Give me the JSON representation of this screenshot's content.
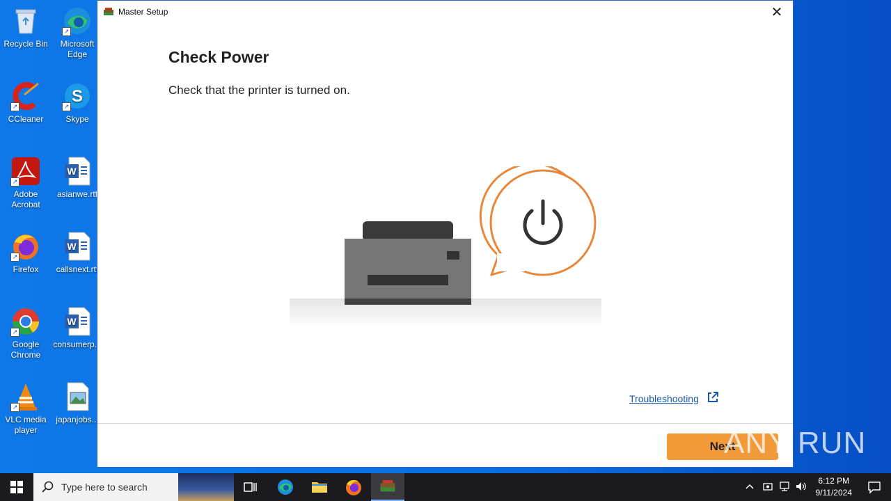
{
  "desktop": {
    "icons": [
      {
        "label": "Recycle Bin"
      },
      {
        "label": "Microsoft Edge"
      },
      {
        "label": "CCleaner"
      },
      {
        "label": "Skype"
      },
      {
        "label": "Adobe Acrobat"
      },
      {
        "label": "asianwe.rtf"
      },
      {
        "label": "Firefox"
      },
      {
        "label": "callsnext.rtf"
      },
      {
        "label": "Google Chrome"
      },
      {
        "label": "consumerp..."
      },
      {
        "label": "VLC media player"
      },
      {
        "label": "japanjobs..."
      }
    ]
  },
  "window": {
    "title": "Master Setup",
    "close_glyph": "✕",
    "heading": "Check Power",
    "subtext": "Check that the printer is turned on.",
    "troubleshooting_link": "Troubleshooting",
    "next_label": "Next",
    "accent_color": "#f29a3a",
    "power_icon_color": "#e8873a"
  },
  "watermark": "ANY RUN",
  "taskbar": {
    "search_placeholder": "Type here to search",
    "time": "6:12 PM",
    "date": "9/11/2024"
  }
}
